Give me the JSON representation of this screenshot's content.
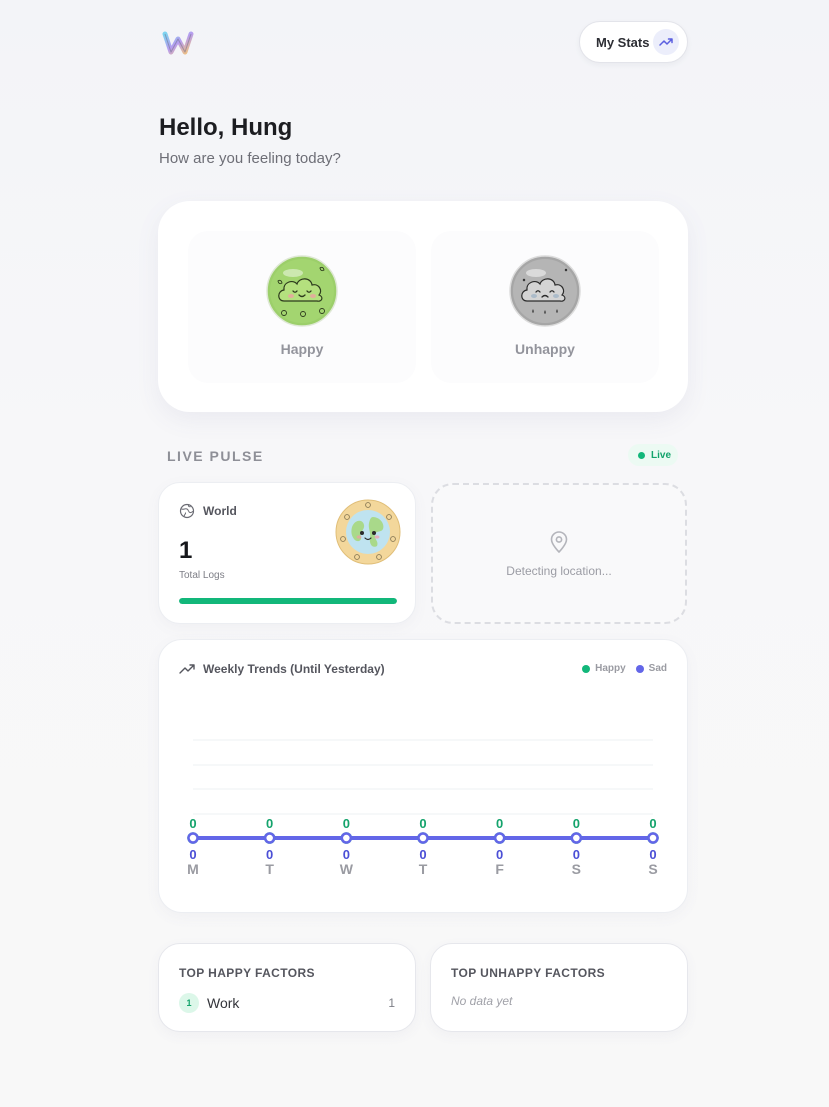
{
  "header": {
    "logo_icon": "w-logo-icon",
    "stats_button_label": "My Stats",
    "stats_icon": "trending-up-icon"
  },
  "greeting": {
    "title": "Hello, Hung",
    "subtitle": "How are you feeling today?"
  },
  "mood": {
    "options": [
      {
        "label": "Happy",
        "icon": "happy-cloud-icon"
      },
      {
        "label": "Unhappy",
        "icon": "sad-cloud-icon"
      }
    ]
  },
  "pulse": {
    "title": "LIVE PULSE",
    "live_label": "Live",
    "world": {
      "label": "World",
      "icon": "globe-icon",
      "count": "1",
      "caption": "Total Logs",
      "happy_fraction": 1.0
    },
    "location": {
      "icon": "map-pin-icon",
      "text": "Detecting location..."
    }
  },
  "weekly": {
    "title": "Weekly Trends (Until Yesterday)",
    "legend": [
      {
        "name": "Happy",
        "color": "#12b77a"
      },
      {
        "name": "Sad",
        "color": "#6366e8"
      }
    ]
  },
  "chart_data": {
    "type": "line",
    "categories": [
      "M",
      "T",
      "W",
      "T",
      "F",
      "S",
      "S"
    ],
    "series": [
      {
        "name": "Happy",
        "color": "#12b77a",
        "values": [
          0,
          0,
          0,
          0,
          0,
          0,
          0
        ]
      },
      {
        "name": "Sad",
        "color": "#6366e8",
        "values": [
          0,
          0,
          0,
          0,
          0,
          0,
          0
        ]
      }
    ],
    "grid": true
  },
  "factors": {
    "happy": {
      "title": "TOP HAPPY FACTORS",
      "items": [
        {
          "rank": "1",
          "name": "Work",
          "count": "1"
        }
      ]
    },
    "unhappy": {
      "title": "TOP UNHAPPY FACTORS",
      "empty_text": "No data yet"
    }
  }
}
